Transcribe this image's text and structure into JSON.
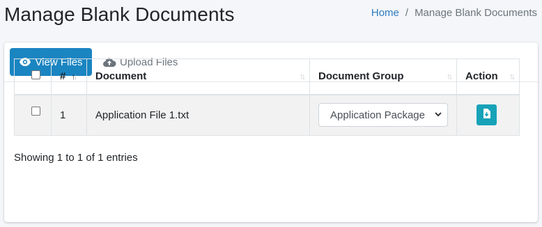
{
  "page": {
    "title": "Manage Blank Documents"
  },
  "breadcrumb": {
    "home": "Home",
    "separator": "/",
    "current": "Manage Blank Documents"
  },
  "tabs": [
    {
      "label": "View Files",
      "icon": "eye-icon",
      "active": true
    },
    {
      "label": "Upload Files",
      "icon": "cloud-upload-icon",
      "active": false
    }
  ],
  "table": {
    "columns": [
      "#",
      "Document",
      "Document Group",
      "Action"
    ],
    "rows": [
      {
        "num": "1",
        "document": "Application File 1.txt",
        "group": "Application Package",
        "action_icon": "download-file-icon"
      }
    ]
  },
  "footer": {
    "info": "Showing 1 to 1 of 1 entries"
  },
  "colors": {
    "primary": "#1a85c1",
    "info": "#17a2b8",
    "link": "#2d7cc0"
  }
}
